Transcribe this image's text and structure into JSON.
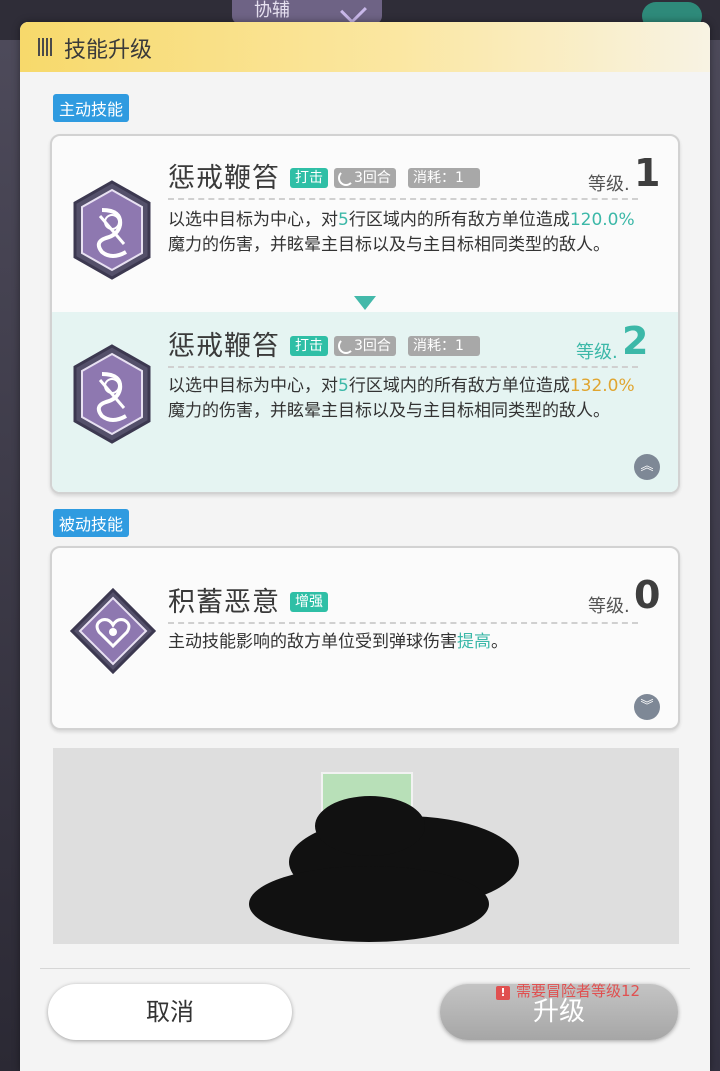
{
  "background": {
    "tab_label": "协辅"
  },
  "modal": {
    "title": "技能升级"
  },
  "active_section": {
    "tag": "主动技能",
    "current": {
      "name": "惩戒鞭笞",
      "type": "打击",
      "rounds": "3回合",
      "cost": "消耗：1",
      "level_label": "等级.",
      "level": "1",
      "desc_a": "以选中目标为中心，对",
      "desc_rows": "5",
      "desc_b": "行区域内的所有敌方单位造成",
      "desc_pct": "120.0%",
      "desc_c": "魔力的伤害，并眩晕主目标以及与主目标相同类型的敌人。"
    },
    "next": {
      "name": "惩戒鞭笞",
      "type": "打击",
      "rounds": "3回合",
      "cost": "消耗：1",
      "level_label": "等级.",
      "level": "2",
      "desc_a": "以选中目标为中心，对",
      "desc_rows": "5",
      "desc_b": "行区域内的所有敌方单位造成",
      "desc_pct": "132.0%",
      "desc_c": "魔力的伤害，并眩晕主目标以及与主目标相同类型的敌人。"
    }
  },
  "passive_section": {
    "tag": "被动技能",
    "skill": {
      "name": "积蓄恶意",
      "type": "增强",
      "level_label": "等级.",
      "level": "0",
      "desc_a": "主动技能影响的敌方单位受到弹球伤害",
      "desc_hl": "提高",
      "desc_b": "。"
    }
  },
  "footer": {
    "cancel_label": "取消",
    "upgrade_label": "升级",
    "requirement": "需要冒险者等级12"
  },
  "colors": {
    "accent_teal": "#3cb8a8",
    "highlight_gold": "#e0a530",
    "tag_blue": "#2f9be0",
    "header_yellow": "#f7d96b"
  }
}
